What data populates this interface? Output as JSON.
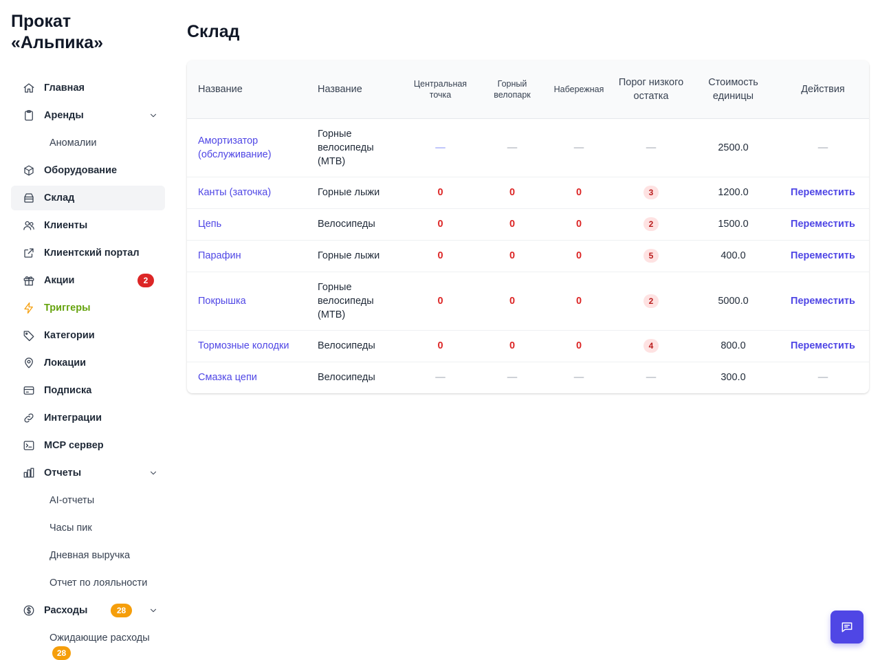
{
  "app": {
    "brand": "Прокат «Альпика»"
  },
  "sidebar": {
    "items": [
      {
        "label": "Главная",
        "icon": "home-icon"
      },
      {
        "label": "Аренды",
        "icon": "clipboard-icon"
      },
      {
        "label": "Аномалии"
      },
      {
        "label": "Оборудование",
        "icon": "box-icon"
      },
      {
        "label": "Склад",
        "icon": "archive-icon",
        "active": true
      },
      {
        "label": "Клиенты",
        "icon": "users-icon"
      },
      {
        "label": "Клиентский портал",
        "icon": "external-link-icon"
      },
      {
        "label": "Акции",
        "icon": "gift-icon",
        "badge": "2"
      },
      {
        "label": "Триггеры",
        "icon": "lightning-icon"
      },
      {
        "label": "Категории",
        "icon": "tag-icon"
      },
      {
        "label": "Локации",
        "icon": "map-pin-icon"
      },
      {
        "label": "Подписка",
        "icon": "credit-card-icon"
      },
      {
        "label": "Интеграции",
        "icon": "link-icon"
      },
      {
        "label": "MCP сервер",
        "icon": "terminal-icon"
      },
      {
        "label": "Отчеты",
        "icon": "bar-chart-icon"
      },
      {
        "label": "AI-отчеты"
      },
      {
        "label": "Часы пик"
      },
      {
        "label": "Дневная выручка"
      },
      {
        "label": "Отчет по лояльности"
      },
      {
        "label": "Расходы",
        "icon": "dollar-icon",
        "badge": "28"
      },
      {
        "label": "Ожидающие расходы",
        "badge": "28"
      }
    ]
  },
  "main": {
    "title": "Склад",
    "table": {
      "headers": [
        "Название",
        "Название",
        "Центральная точка",
        "Горный велопарк",
        "Набережная",
        "Порог низкого остатка",
        "Стоимость единицы",
        "Действия"
      ],
      "rows": [
        {
          "name": "Амортизатор (обслуживание)",
          "category": "Горные велосипеды (MTB)",
          "central": "—",
          "bikepark": "—",
          "embankment": "—",
          "threshold": "—",
          "cost": "2500.0",
          "action": "—"
        },
        {
          "name": "Канты (заточка)",
          "category": "Горные лыжи",
          "central": "0",
          "bikepark": "0",
          "embankment": "0",
          "threshold": "3",
          "cost": "1200.0",
          "action": "Переместить"
        },
        {
          "name": "Цепь",
          "category": "Велосипеды",
          "central": "0",
          "bikepark": "0",
          "embankment": "0",
          "threshold": "2",
          "cost": "1500.0",
          "action": "Переместить"
        },
        {
          "name": "Парафин",
          "category": "Горные лыжи",
          "central": "0",
          "bikepark": "0",
          "embankment": "0",
          "threshold": "5",
          "cost": "400.0",
          "action": "Переместить"
        },
        {
          "name": "Покрышка",
          "category": "Горные велосипеды (MTB)",
          "central": "0",
          "bikepark": "0",
          "embankment": "0",
          "threshold": "2",
          "cost": "5000.0",
          "action": "Переместить"
        },
        {
          "name": "Тормозные колодки",
          "category": "Велосипеды",
          "central": "0",
          "bikepark": "0",
          "embankment": "0",
          "threshold": "4",
          "cost": "800.0",
          "action": "Переместить"
        },
        {
          "name": "Смазка цепи",
          "category": "Велосипеды",
          "central": "—",
          "bikepark": "—",
          "embankment": "—",
          "threshold": "—",
          "cost": "300.0",
          "action": "—"
        }
      ]
    }
  },
  "chat": {
    "icon": "chat-icon"
  },
  "colors": {
    "accent": "#4f46e5",
    "danger": "#dc2626",
    "warning": "#f59e0b",
    "active_bg": "#f3f4f6"
  }
}
